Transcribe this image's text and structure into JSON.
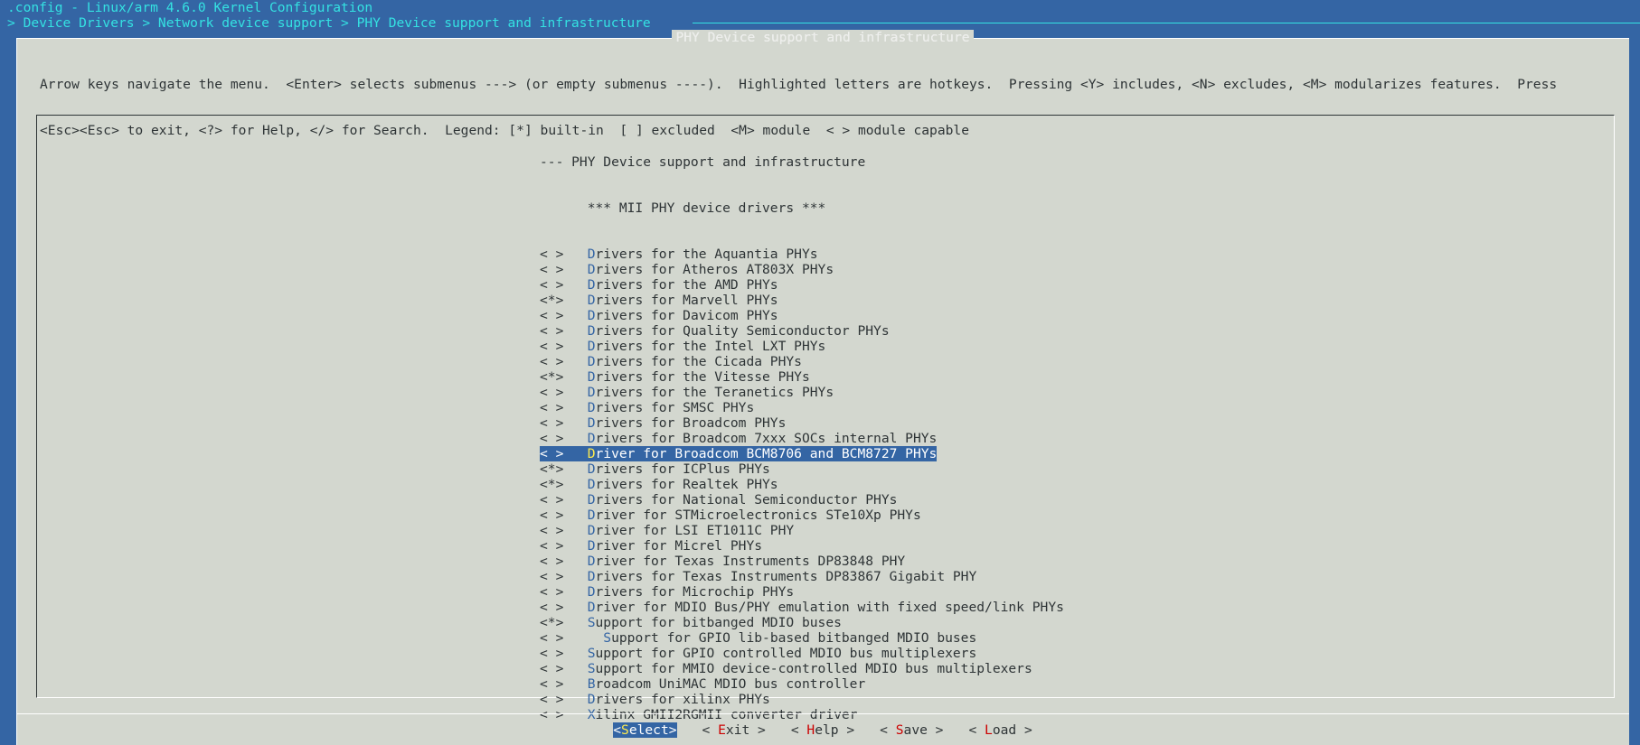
{
  "title": ".config - Linux/arm 4.6.0 Kernel Configuration",
  "breadcrumb": "> Device Drivers > Network device support > PHY Device support and infrastructure",
  "dialog": {
    "title": "PHY Device support and infrastructure",
    "help_lines": [
      "Arrow keys navigate the menu.  <Enter> selects submenus ---> (or empty submenus ----).  Highlighted letters are hotkeys.  Pressing <Y> includes, <N> excludes, <M> modularizes features.  Press",
      "<Esc><Esc> to exit, <?> for Help, </> for Search.  Legend: [*] built-in  [ ] excluded  <M> module  < > module capable"
    ]
  },
  "menu": {
    "header": "--- PHY Device support and infrastructure",
    "comment": "      *** MII PHY device drivers ***",
    "selected_index": 13,
    "items": [
      {
        "state": "< >",
        "indent": "",
        "label": "Drivers for the Aquantia PHYs"
      },
      {
        "state": "< >",
        "indent": "",
        "label": "Drivers for Atheros AT803X PHYs"
      },
      {
        "state": "< >",
        "indent": "",
        "label": "Drivers for the AMD PHYs"
      },
      {
        "state": "<*>",
        "indent": "",
        "label": "Drivers for Marvell PHYs"
      },
      {
        "state": "< >",
        "indent": "",
        "label": "Drivers for Davicom PHYs"
      },
      {
        "state": "< >",
        "indent": "",
        "label": "Drivers for Quality Semiconductor PHYs"
      },
      {
        "state": "< >",
        "indent": "",
        "label": "Drivers for the Intel LXT PHYs"
      },
      {
        "state": "< >",
        "indent": "",
        "label": "Drivers for the Cicada PHYs"
      },
      {
        "state": "<*>",
        "indent": "",
        "label": "Drivers for the Vitesse PHYs"
      },
      {
        "state": "< >",
        "indent": "",
        "label": "Drivers for the Teranetics PHYs"
      },
      {
        "state": "< >",
        "indent": "",
        "label": "Drivers for SMSC PHYs"
      },
      {
        "state": "< >",
        "indent": "",
        "label": "Drivers for Broadcom PHYs"
      },
      {
        "state": "< >",
        "indent": "",
        "label": "Drivers for Broadcom 7xxx SOCs internal PHYs"
      },
      {
        "state": "< >",
        "indent": "",
        "label": "Driver for Broadcom BCM8706 and BCM8727 PHYs"
      },
      {
        "state": "<*>",
        "indent": "",
        "label": "Drivers for ICPlus PHYs"
      },
      {
        "state": "<*>",
        "indent": "",
        "label": "Drivers for Realtek PHYs"
      },
      {
        "state": "< >",
        "indent": "",
        "label": "Drivers for National Semiconductor PHYs"
      },
      {
        "state": "< >",
        "indent": "",
        "label": "Driver for STMicroelectronics STe10Xp PHYs"
      },
      {
        "state": "< >",
        "indent": "",
        "label": "Driver for LSI ET1011C PHY"
      },
      {
        "state": "< >",
        "indent": "",
        "label": "Driver for Micrel PHYs"
      },
      {
        "state": "< >",
        "indent": "",
        "label": "Driver for Texas Instruments DP83848 PHY"
      },
      {
        "state": "< >",
        "indent": "",
        "label": "Drivers for Texas Instruments DP83867 Gigabit PHY"
      },
      {
        "state": "< >",
        "indent": "",
        "label": "Drivers for Microchip PHYs"
      },
      {
        "state": "< >",
        "indent": "",
        "label": "Driver for MDIO Bus/PHY emulation with fixed speed/link PHYs"
      },
      {
        "state": "<*>",
        "indent": "",
        "label": "Support for bitbanged MDIO buses"
      },
      {
        "state": "< >",
        "indent": "  ",
        "label": "Support for GPIO lib-based bitbanged MDIO buses"
      },
      {
        "state": "< >",
        "indent": "",
        "label": "Support for GPIO controlled MDIO bus multiplexers"
      },
      {
        "state": "< >",
        "indent": "",
        "label": "Support for MMIO device-controlled MDIO bus multiplexers"
      },
      {
        "state": "< >",
        "indent": "",
        "label": "Broadcom UniMAC MDIO bus controller"
      },
      {
        "state": "< >",
        "indent": "",
        "label": "Drivers for xilinx PHYs"
      },
      {
        "state": "< >",
        "indent": "",
        "label": "Xilinx GMII2RGMII converter driver"
      }
    ]
  },
  "buttons": [
    {
      "pre": "<",
      "hotkey": "S",
      "rest": "elect>",
      "name": "select",
      "active": true
    },
    {
      "pre": "< ",
      "hotkey": "E",
      "rest": "xit >",
      "name": "exit",
      "active": false
    },
    {
      "pre": "< ",
      "hotkey": "H",
      "rest": "elp >",
      "name": "help",
      "active": false
    },
    {
      "pre": "< ",
      "hotkey": "S",
      "rest": "ave >",
      "name": "save",
      "active": false
    },
    {
      "pre": "< ",
      "hotkey": "L",
      "rest": "oad >",
      "name": "load",
      "active": false
    }
  ]
}
